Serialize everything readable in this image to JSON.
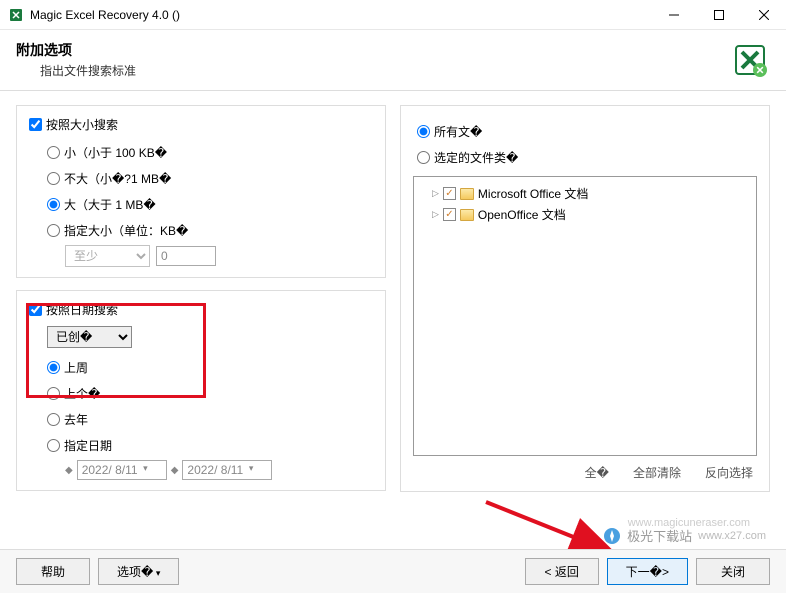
{
  "window": {
    "title": "Magic Excel Recovery 4.0 ()"
  },
  "header": {
    "title": "附加选项",
    "subtitle": "指出文件搜索标准"
  },
  "sizeGroup": {
    "label": "按照大小搜索",
    "options": {
      "small": "小（小于 100 KB�",
      "medium": "不大（小�?1 MB�",
      "large": "大（大于 1 MB�",
      "custom": "指定大小（单位：KB�"
    },
    "customControls": {
      "atLeast": "至少",
      "value": "0"
    }
  },
  "dateGroup": {
    "label": "按照日期搜索",
    "dateType": "已创�",
    "options": {
      "lastWeek": "上周",
      "lastMonth": "上个�",
      "lastYear": "去年",
      "custom": "指定日期"
    },
    "dateFrom": "2022/ 8/11",
    "dateTo": "2022/ 8/11"
  },
  "fileTypes": {
    "allFiles": "所有文�",
    "selectedTypes": "选定的文件类�",
    "tree": {
      "item1": "Microsoft Office 文档",
      "item2": "OpenOffice 文档"
    },
    "actions": {
      "selectAll": "全�",
      "clearAll": "全部清除",
      "invert": "反向选择"
    }
  },
  "footer": {
    "help": "帮助",
    "options": "选项�",
    "back": "< 返回",
    "next": "下一�>",
    "close": "关闭"
  },
  "watermarks": {
    "url": "www.magicuneraser.com",
    "site": "极光下载站",
    "siteUrl": "www.x27.com"
  }
}
